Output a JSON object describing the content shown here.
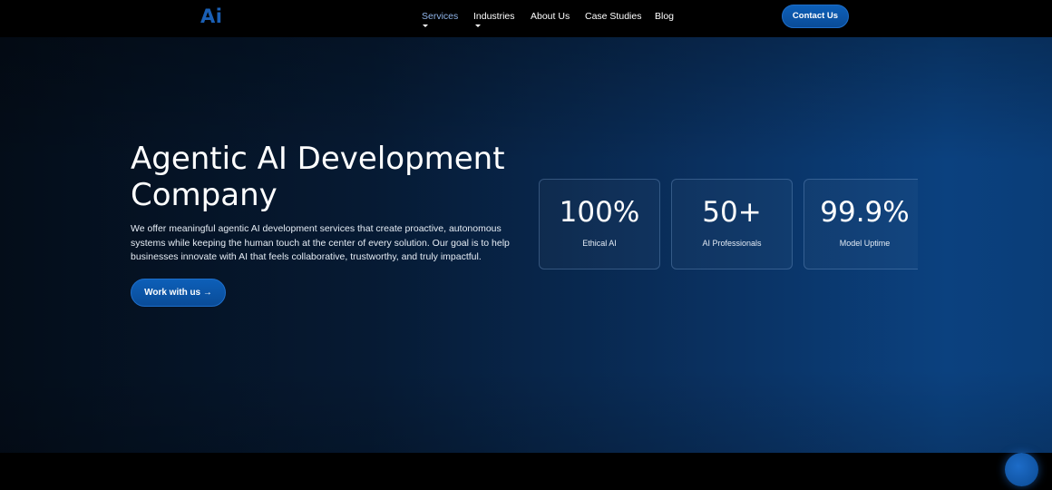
{
  "header": {
    "logo": "Ai",
    "nav": {
      "services": "Services",
      "industries": "Industries",
      "about": "About Us",
      "case_studies": "Case Studies",
      "blog": "Blog"
    },
    "contact_label": "Contact Us"
  },
  "hero": {
    "title": "Agentic AI Development Company",
    "description": "We offer meaningful agentic AI development services that create proactive, autonomous systems while keeping the human touch at the center of every solution. Our goal is to help businesses innovate with AI that feels collaborative, trustworthy, and truly impactful.",
    "cta_label": "Work with us →",
    "stats": [
      {
        "value": "100%",
        "label": "Ethical AI"
      },
      {
        "value": "50+",
        "label": "AI Professionals"
      },
      {
        "value": "99.9%",
        "label": "Model Uptime"
      }
    ]
  },
  "colors": {
    "accent": "#0d5fb8",
    "active_nav": "#8fb4e8",
    "logo": "#1a5fb4"
  },
  "chat": {
    "icon": "chat-bubble-icon"
  }
}
